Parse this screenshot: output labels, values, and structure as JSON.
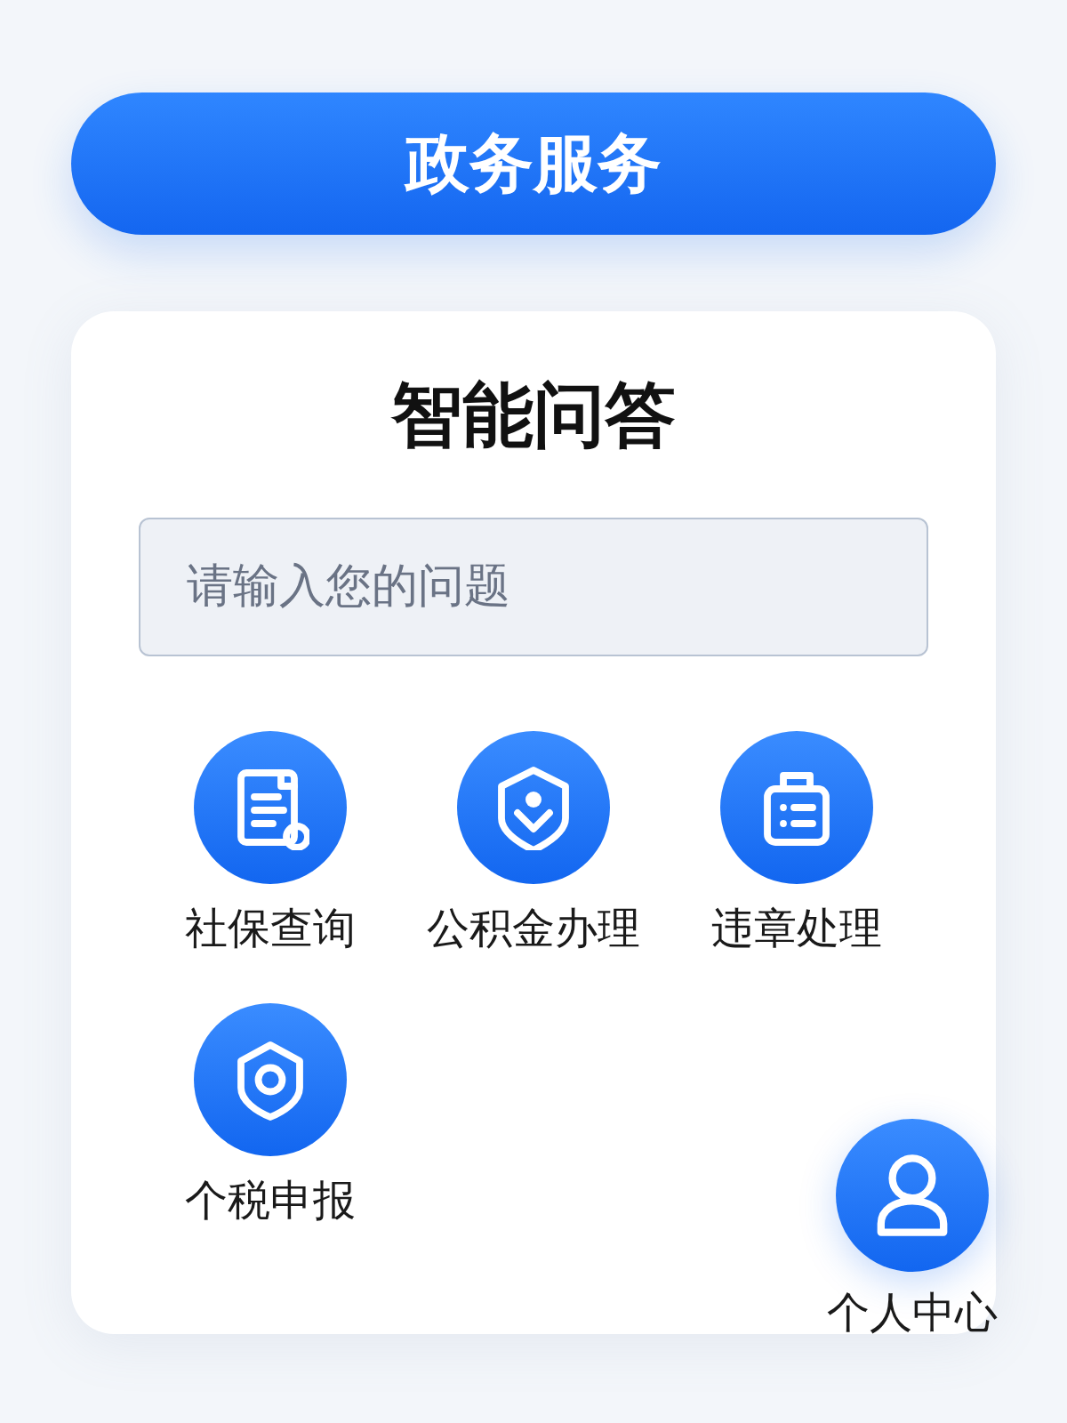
{
  "header": {
    "title": "政务服务"
  },
  "card": {
    "title": "智能问答",
    "search": {
      "placeholder": "请输入您的问题"
    },
    "services": [
      {
        "label": "社保查询",
        "kind": "document"
      },
      {
        "label": "公积金办理",
        "kind": "shield-person"
      },
      {
        "label": "违章处理",
        "kind": "briefcase"
      },
      {
        "label": "个税申报",
        "kind": "shield-ring"
      }
    ]
  },
  "fab": {
    "label": "个人中心"
  }
}
